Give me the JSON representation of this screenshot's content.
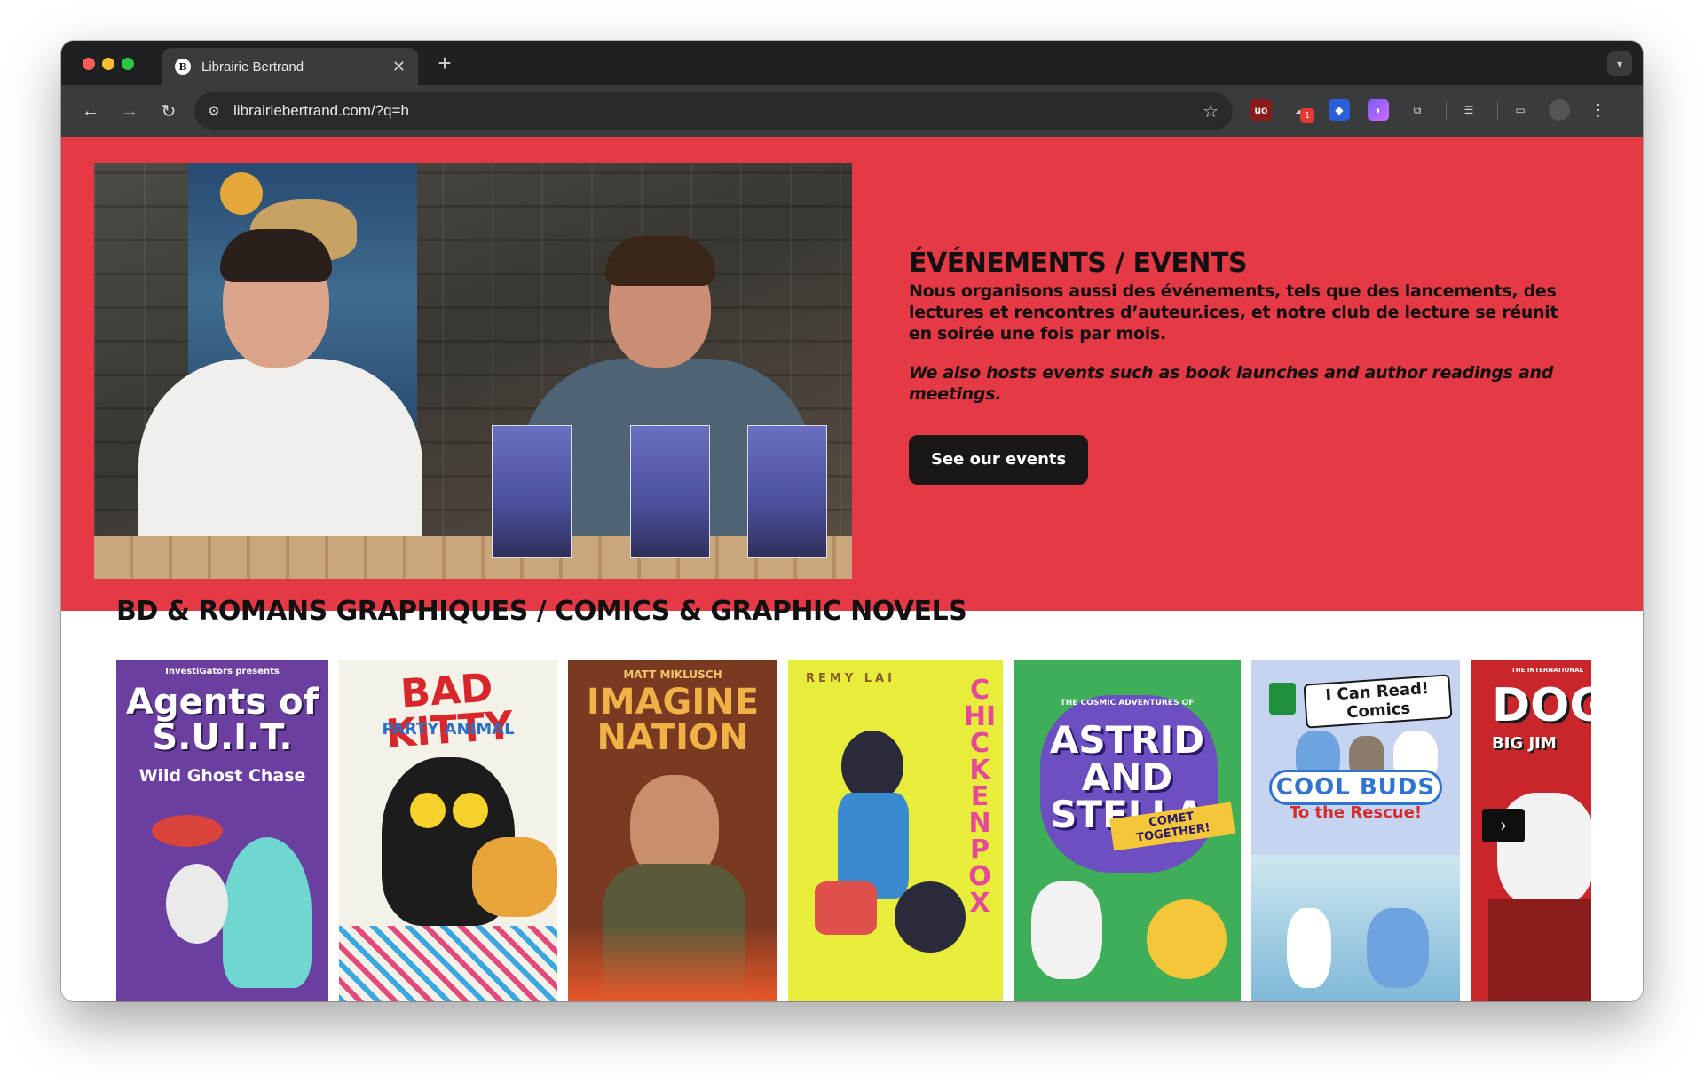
{
  "browser": {
    "tab_title": "Librairie Bertrand",
    "tab_favicon_letter": "B",
    "url": "librairiebertrand.com/?q=h",
    "extension_badge": "1"
  },
  "hero": {
    "heading": "ÉVÉNEMENTS / EVENTS",
    "text_fr": "Nous organisons aussi des événements, tels que des lancements, des lectures et rencontres d’auteur.ices, et notre club de lecture se réunit en soirée une fois par mois.",
    "text_en": "We also hosts events such as book launches and author readings and meetings.",
    "button_label": "See our events",
    "background_color": "#e63946",
    "button_color": "#1b1717"
  },
  "comics": {
    "title": "BD & ROMANS GRAPHIQUES / COMICS & GRAPHIC NOVELS",
    "books": [
      {
        "top": "InvestiGators presents",
        "title": "Agents of S.U.I.T.",
        "sub": "Wild Ghost Chase",
        "bg": "#6a3fa0"
      },
      {
        "top": "",
        "title": "BAD KITTY",
        "sub": "PARTY ANIMAL",
        "bg": "#f4f1e8"
      },
      {
        "top": "MATT MIKLUSCH",
        "title": "IMAGINE NATION",
        "sub": "",
        "bg": "#7a3a22"
      },
      {
        "top": "REMY LAI",
        "title": "CHICKENPOX",
        "sub": "",
        "bg": "#e8ec3a"
      },
      {
        "top": "THE COSMIC ADVENTURES OF",
        "title": "ASTRID AND STELLA",
        "sub": "COMET TOGETHER!",
        "bg": "#3fae58"
      },
      {
        "top": "I Can Read! Comics",
        "title": "COOL BUDS",
        "sub": "To the Rescue!",
        "bg": "#c6d4ef"
      },
      {
        "top": "THE INTERNATIONAL",
        "title": "DOG",
        "sub": "BIG JIM",
        "bg": "#c9262c"
      }
    ]
  },
  "icons": {
    "back": "arrow-left-icon",
    "forward": "arrow-right-icon",
    "reload": "reload-icon",
    "site_info": "tune-icon",
    "bookmark": "star-icon",
    "next": "chevron-right-icon"
  }
}
